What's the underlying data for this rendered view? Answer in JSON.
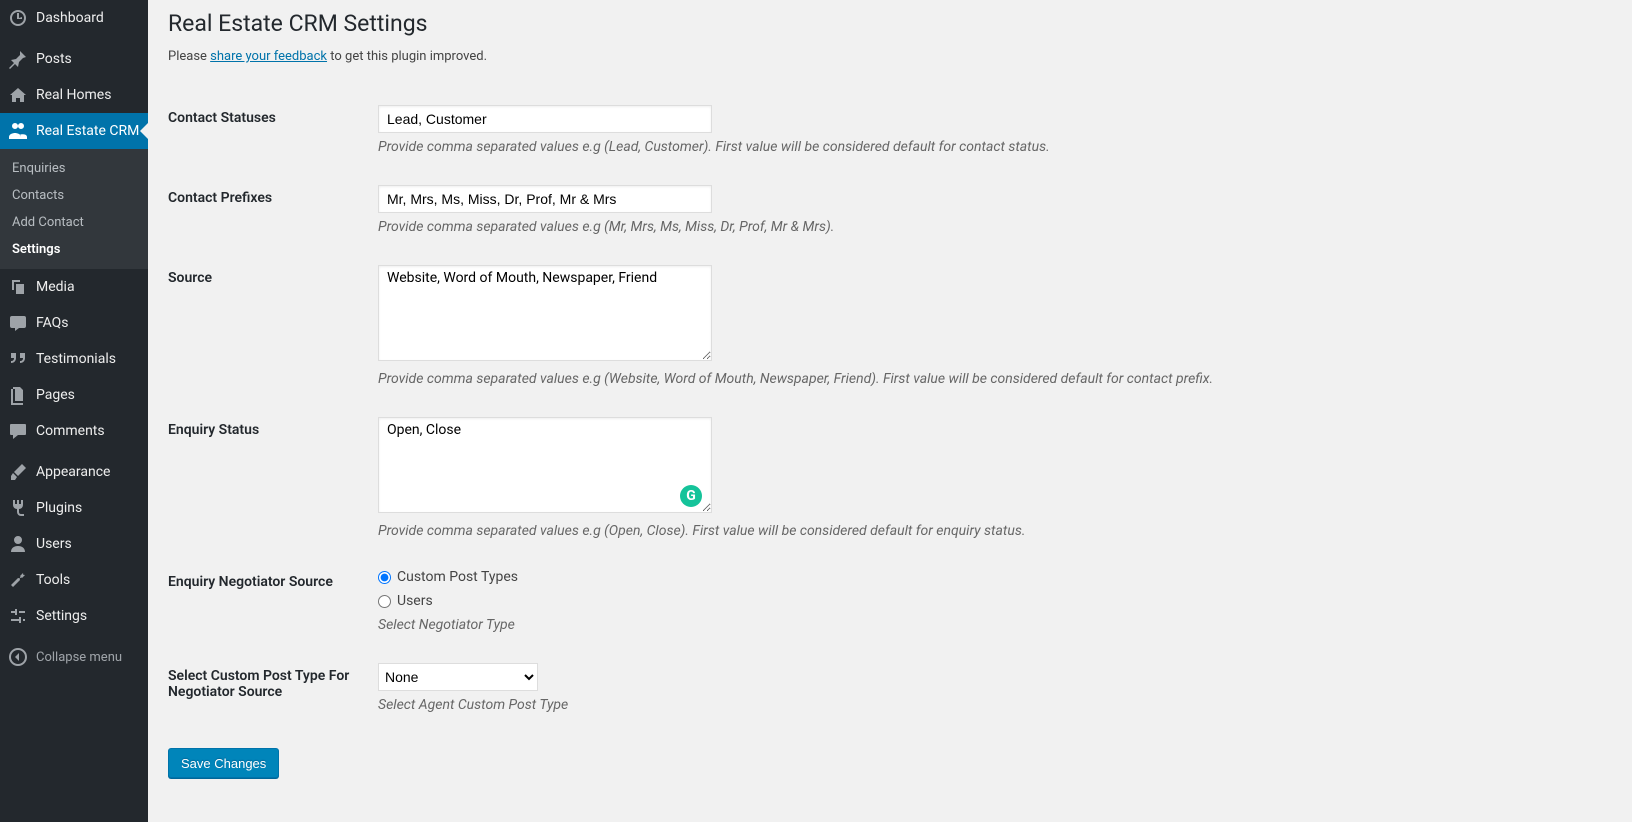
{
  "sidebar": {
    "items": [
      {
        "label": "Dashboard",
        "icon": "dashboard"
      },
      {
        "label": "Posts",
        "icon": "pin"
      },
      {
        "label": "Real Homes",
        "icon": "homes"
      },
      {
        "label": "Real Estate CRM",
        "icon": "crm",
        "active": true
      },
      {
        "label": "Media",
        "icon": "media"
      },
      {
        "label": "FAQs",
        "icon": "faq"
      },
      {
        "label": "Testimonials",
        "icon": "quote"
      },
      {
        "label": "Pages",
        "icon": "pages"
      },
      {
        "label": "Comments",
        "icon": "comment"
      },
      {
        "label": "Appearance",
        "icon": "brush"
      },
      {
        "label": "Plugins",
        "icon": "plug"
      },
      {
        "label": "Users",
        "icon": "user"
      },
      {
        "label": "Tools",
        "icon": "wrench"
      },
      {
        "label": "Settings",
        "icon": "sliders"
      },
      {
        "label": "Collapse menu",
        "icon": "collapse"
      }
    ],
    "submenu": [
      {
        "label": "Enquiries"
      },
      {
        "label": "Contacts"
      },
      {
        "label": "Add Contact"
      },
      {
        "label": "Settings",
        "current": true
      }
    ]
  },
  "page": {
    "title": "Real Estate CRM Settings",
    "feedback_prefix": "Please ",
    "feedback_link": "share your feedback",
    "feedback_suffix": " to get this plugin improved."
  },
  "fields": {
    "contact_statuses": {
      "label": "Contact Statuses",
      "value": "Lead, Customer",
      "desc": "Provide comma separated values e.g (Lead, Customer). First value will be considered default for contact status."
    },
    "contact_prefixes": {
      "label": "Contact Prefixes",
      "value": "Mr, Mrs, Ms, Miss, Dr, Prof, Mr & Mrs",
      "desc": "Provide comma separated values e.g (Mr, Mrs, Ms, Miss, Dr, Prof, Mr & Mrs)."
    },
    "source": {
      "label": "Source",
      "value": "Website, Word of Mouth, Newspaper, Friend",
      "desc": "Provide comma separated values e.g (Website, Word of Mouth, Newspaper, Friend). First value will be considered default for contact prefix."
    },
    "enquiry_status": {
      "label": "Enquiry Status",
      "value": "Open, Close",
      "desc": "Provide comma separated values e.g (Open, Close). First value will be considered default for enquiry status."
    },
    "negotiator_source": {
      "label": "Enquiry Negotiator Source",
      "option1": "Custom Post Types",
      "option2": "Users",
      "desc": "Select Negotiator Type"
    },
    "cpt_negotiator": {
      "label": "Select Custom Post Type For Negotiator Source",
      "value": "None",
      "desc": "Select Agent Custom Post Type"
    }
  },
  "buttons": {
    "save": "Save Changes"
  }
}
